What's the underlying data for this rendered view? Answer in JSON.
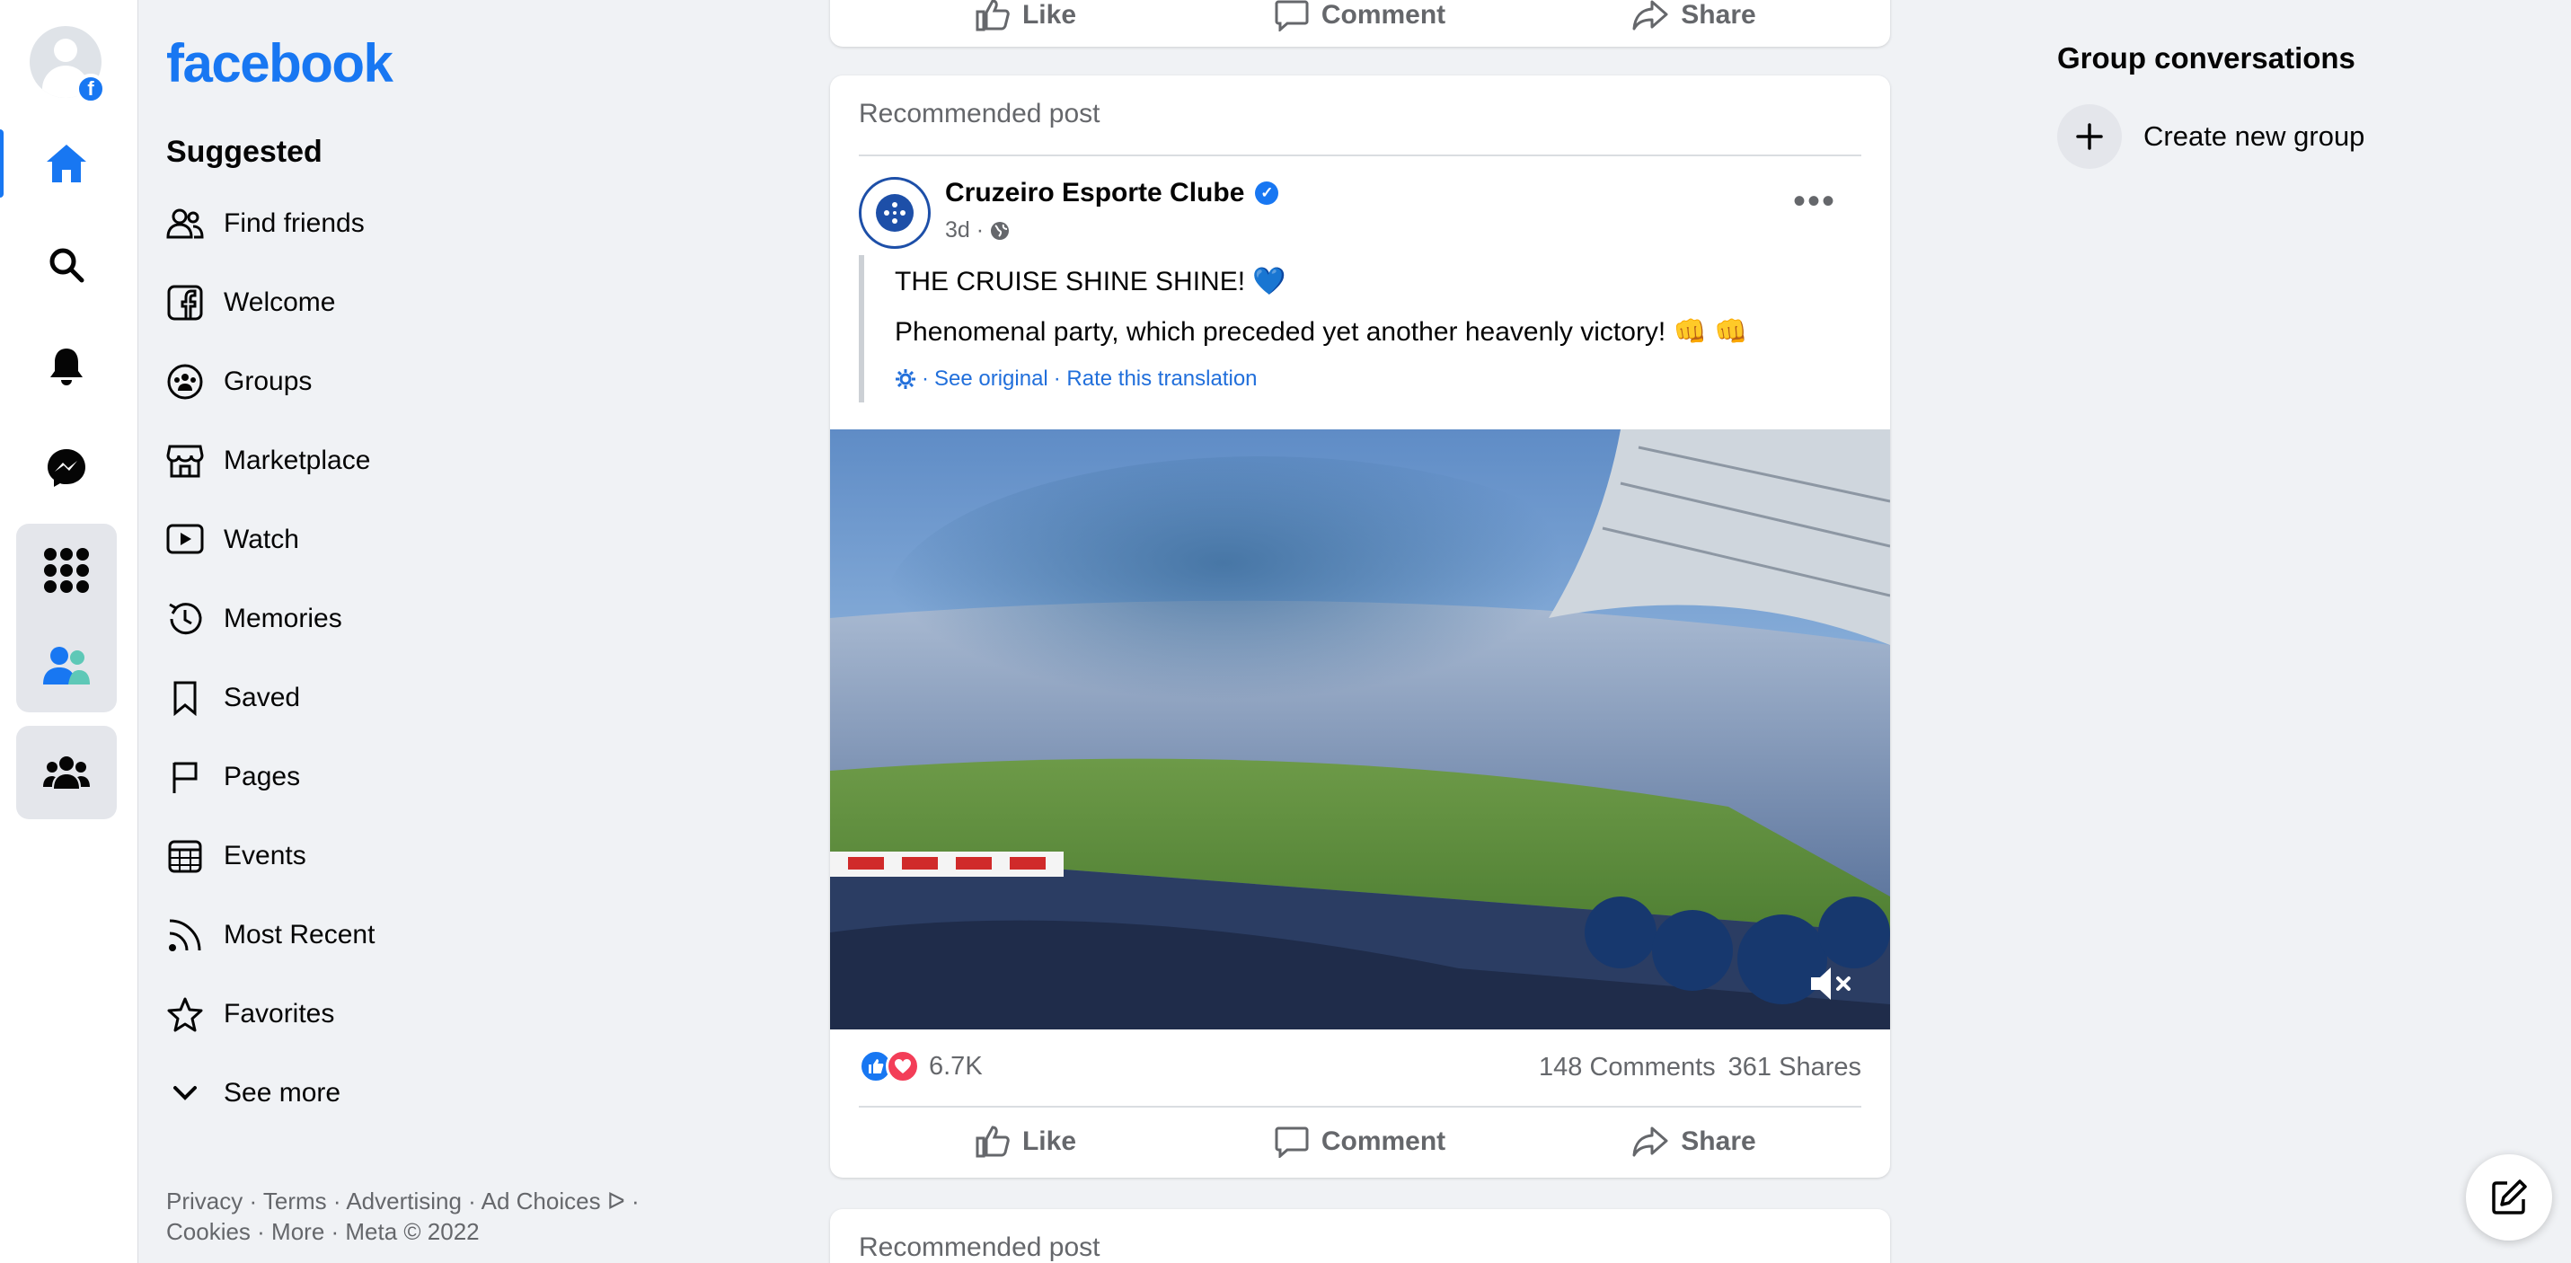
{
  "rail": {
    "items": [
      {
        "name": "home",
        "active": true
      },
      {
        "name": "search"
      },
      {
        "name": "notifications"
      },
      {
        "name": "messenger"
      },
      {
        "name": "menu"
      },
      {
        "name": "friends"
      },
      {
        "name": "groups"
      }
    ]
  },
  "nav": {
    "logo": "facebook",
    "section_title": "Suggested",
    "items": [
      {
        "label": "Find friends",
        "icon": "friends-icon"
      },
      {
        "label": "Welcome",
        "icon": "facebook-icon"
      },
      {
        "label": "Groups",
        "icon": "groups-icon"
      },
      {
        "label": "Marketplace",
        "icon": "marketplace-icon"
      },
      {
        "label": "Watch",
        "icon": "watch-icon"
      },
      {
        "label": "Memories",
        "icon": "memories-icon"
      },
      {
        "label": "Saved",
        "icon": "bookmark-icon"
      },
      {
        "label": "Pages",
        "icon": "flag-icon"
      },
      {
        "label": "Events",
        "icon": "calendar-icon"
      },
      {
        "label": "Most Recent",
        "icon": "feed-icon"
      },
      {
        "label": "Favorites",
        "icon": "star-icon"
      },
      {
        "label": "See more",
        "icon": "chevron-down-icon"
      }
    ],
    "footer_line1": "Privacy · Terms · Advertising · Ad Choices ᐅ ·",
    "footer_line2": "Cookies · More · Meta © 2022"
  },
  "prev_post": {
    "like": "Like",
    "comment": "Comment",
    "share": "Share"
  },
  "post": {
    "label": "Recommended post",
    "page_name": "Cruzeiro Esporte Clube",
    "time": "3d ·",
    "text_line1": "THE CRUISE SHINE SHINE! 💙",
    "text_line2": "Phenomenal party, which preceded yet another heavenly victory! 👊 👊",
    "translation_prefix": "·",
    "see_original": "See original",
    "rate_translation": "· Rate this translation",
    "reaction_count": "6.7K",
    "comments": "148 Comments",
    "shares": "361 Shares",
    "like": "Like",
    "comment": "Comment",
    "share": "Share"
  },
  "next_post": {
    "label": "Recommended post"
  },
  "right": {
    "title": "Group conversations",
    "create_group": "Create new group"
  },
  "colors": {
    "brand": "#1877f2",
    "background": "#f0f2f5",
    "secondary_text": "#65676b",
    "link": "#216fdb"
  }
}
